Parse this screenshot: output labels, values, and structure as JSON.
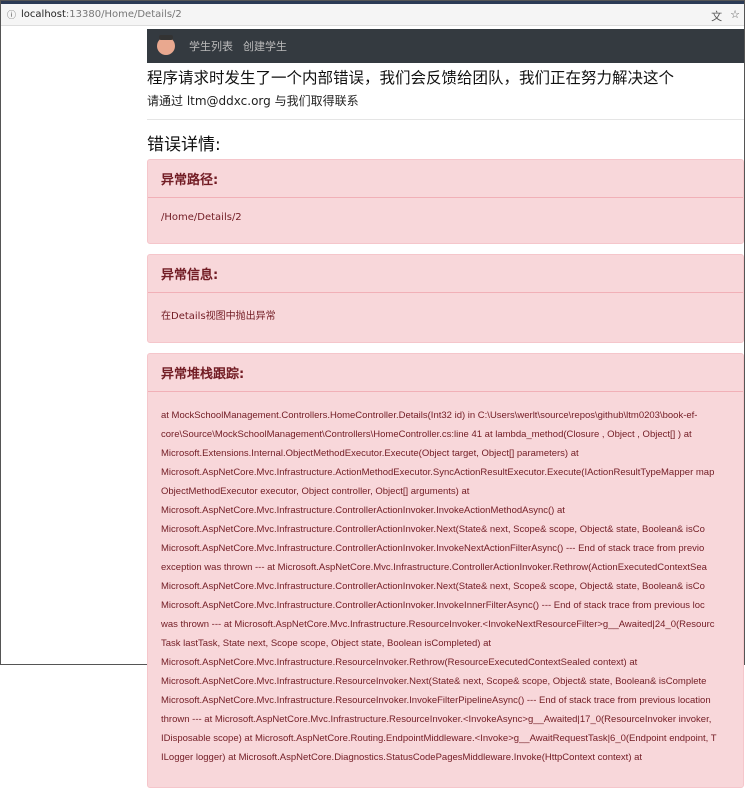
{
  "browser": {
    "host": "localhost",
    "path": ":13380/Home/Details/2"
  },
  "nav": {
    "items": [
      "学生列表",
      "创建学生"
    ]
  },
  "heading": "程序请求时发生了一个内部错误，我们会反馈给团队，我们正在努力解决这个",
  "contact": "请通过 ltm@ddxc.org 与我们取得联系",
  "details_title": "错误详情:",
  "cards": [
    {
      "title": "异常路径:",
      "body": "/Home/Details/2"
    },
    {
      "title": "异常信息:",
      "body": "在Details视图中抛出异常"
    },
    {
      "title": "异常堆栈跟踪:",
      "lines": [
        "at MockSchoolManagement.Controllers.HomeController.Details(Int32 id) in C:\\Users\\werlt\\source\\repos\\github\\ltm0203\\book-ef-",
        "core\\Source\\MockSchoolManagement\\Controllers\\HomeController.cs:line 41 at lambda_method(Closure , Object , Object[] ) at",
        "Microsoft.Extensions.Internal.ObjectMethodExecutor.Execute(Object target, Object[] parameters) at",
        "Microsoft.AspNetCore.Mvc.Infrastructure.ActionMethodExecutor.SyncActionResultExecutor.Execute(IActionResultTypeMapper map",
        "ObjectMethodExecutor executor, Object controller, Object[] arguments) at",
        "Microsoft.AspNetCore.Mvc.Infrastructure.ControllerActionInvoker.InvokeActionMethodAsync() at",
        "Microsoft.AspNetCore.Mvc.Infrastructure.ControllerActionInvoker.Next(State& next, Scope& scope, Object& state, Boolean& isCo",
        "Microsoft.AspNetCore.Mvc.Infrastructure.ControllerActionInvoker.InvokeNextActionFilterAsync() --- End of stack trace from previo",
        "exception was thrown --- at Microsoft.AspNetCore.Mvc.Infrastructure.ControllerActionInvoker.Rethrow(ActionExecutedContextSea",
        "Microsoft.AspNetCore.Mvc.Infrastructure.ControllerActionInvoker.Next(State& next, Scope& scope, Object& state, Boolean& isCo",
        "Microsoft.AspNetCore.Mvc.Infrastructure.ControllerActionInvoker.InvokeInnerFilterAsync() --- End of stack trace from previous loc",
        "was thrown --- at Microsoft.AspNetCore.Mvc.Infrastructure.ResourceInvoker.<InvokeNextResourceFilter>g__Awaited|24_0(Resourc",
        "Task lastTask, State next, Scope scope, Object state, Boolean isCompleted) at",
        "Microsoft.AspNetCore.Mvc.Infrastructure.ResourceInvoker.Rethrow(ResourceExecutedContextSealed context) at",
        "Microsoft.AspNetCore.Mvc.Infrastructure.ResourceInvoker.Next(State& next, Scope& scope, Object& state, Boolean& isComplete",
        "Microsoft.AspNetCore.Mvc.Infrastructure.ResourceInvoker.InvokeFilterPipelineAsync() --- End of stack trace from previous location",
        "thrown --- at Microsoft.AspNetCore.Mvc.Infrastructure.ResourceInvoker.<InvokeAsync>g__Awaited|17_0(ResourceInvoker invoker,",
        "IDisposable scope) at Microsoft.AspNetCore.Routing.EndpointMiddleware.<Invoke>g__AwaitRequestTask|6_0(Endpoint endpoint, T",
        "ILogger logger) at Microsoft.AspNetCore.Diagnostics.StatusCodePagesMiddleware.Invoke(HttpContext context) at"
      ]
    }
  ]
}
